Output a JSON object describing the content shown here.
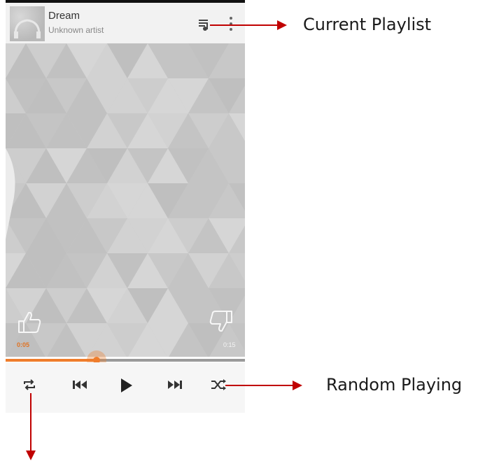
{
  "track": {
    "title": "Dream",
    "artist": "Unknown artist"
  },
  "player": {
    "elapsed": "0:05",
    "total": "0:15",
    "progress": 0.38,
    "accent_color": "#ef7d2c"
  },
  "annotations": {
    "playlist": "Current Playlist",
    "shuffle": "Random Playing",
    "arrow_color": "#c00000"
  },
  "icons": {
    "header": [
      "album-thumbnail",
      "playlist-icon",
      "more-vert-icon"
    ],
    "ratings": [
      "thumb-up-icon",
      "thumb-down-icon"
    ],
    "controls": [
      "repeat-icon",
      "previous-icon",
      "play-icon",
      "next-icon",
      "shuffle-icon"
    ]
  }
}
